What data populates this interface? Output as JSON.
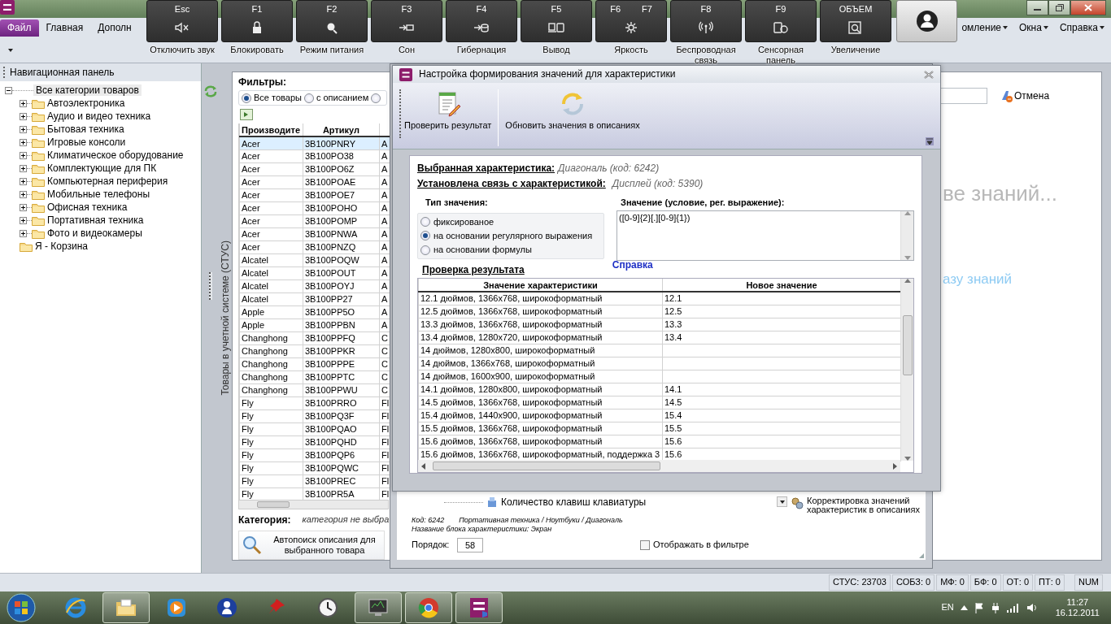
{
  "ribbon": {
    "tabs": [
      {
        "label": "Файл",
        "selected": true
      },
      {
        "label": "Главная",
        "selected": false
      },
      {
        "label": "Дополн",
        "selected": false
      }
    ],
    "menus": [
      "омление",
      "Окна",
      "Справка"
    ]
  },
  "function_keys": [
    {
      "keys": [
        "Esc"
      ],
      "caption": "Отключить звук"
    },
    {
      "keys": [
        "F1"
      ],
      "caption": "Блокировать"
    },
    {
      "keys": [
        "F2"
      ],
      "caption": "Режим питания"
    },
    {
      "keys": [
        "F3"
      ],
      "caption": "Сон"
    },
    {
      "keys": [
        "F4"
      ],
      "caption": "Гибернация"
    },
    {
      "keys": [
        "F5"
      ],
      "caption": "Вывод"
    },
    {
      "keys": [
        "F6",
        "F7"
      ],
      "caption": "Яркость"
    },
    {
      "keys": [
        "F8"
      ],
      "caption": "Беспроводная связь"
    },
    {
      "keys": [
        "F9"
      ],
      "caption": "Сенсорная панель"
    },
    {
      "keys": [
        "ОБЪЕМ"
      ],
      "caption": "Увеличение"
    }
  ],
  "nav_panel": {
    "title": "Навигационная панель",
    "tree": {
      "label": "Все категории товаров",
      "expanded": true,
      "selected": true,
      "children": [
        {
          "label": "Автоэлектроника",
          "expanded": false,
          "selected": false
        },
        {
          "label": "Аудио и видео техника",
          "expanded": false,
          "selected": false
        },
        {
          "label": "Бытовая техника",
          "expanded": false,
          "selected": false
        },
        {
          "label": "Игровые консоли",
          "expanded": false,
          "selected": false
        },
        {
          "label": "Климатическое оборудование",
          "expanded": false,
          "selected": false
        },
        {
          "label": "Комплектующие для ПК",
          "expanded": false,
          "selected": false
        },
        {
          "label": "Компьютерная периферия",
          "expanded": false,
          "selected": false
        },
        {
          "label": "Мобильные телефоны",
          "expanded": false,
          "selected": false
        },
        {
          "label": "Офисная техника",
          "expanded": false,
          "selected": false
        },
        {
          "label": "Портативная техника",
          "expanded": false,
          "selected": false
        },
        {
          "label": "Фото и видеокамеры",
          "expanded": false,
          "selected": false
        },
        {
          "label": "Я - Корзина",
          "selected": false
        }
      ]
    }
  },
  "products": {
    "side_label": "Товары в учетной системе (СТУС)",
    "filters_label": "Фильтры:",
    "filter_options": [
      {
        "label": "Все товары",
        "selected": true
      },
      {
        "label": "с описанием",
        "selected": false
      },
      {
        "selected": false
      }
    ],
    "table": {
      "columns": [
        "Производите",
        "Артикул"
      ],
      "rows": [
        {
          "selected": true,
          "cells": [
            "Acer",
            "3B100PNRY",
            "A"
          ]
        },
        {
          "selected": false,
          "cells": [
            "Acer",
            "3B100PO38",
            "A"
          ]
        },
        {
          "selected": false,
          "cells": [
            "Acer",
            "3B100PO6Z",
            "A"
          ]
        },
        {
          "selected": false,
          "cells": [
            "Acer",
            "3B100POAE",
            "A"
          ]
        },
        {
          "selected": false,
          "cells": [
            "Acer",
            "3B100POE7",
            "A"
          ]
        },
        {
          "selected": false,
          "cells": [
            "Acer",
            "3B100POHO",
            "A"
          ]
        },
        {
          "selected": false,
          "cells": [
            "Acer",
            "3B100POMP",
            "A"
          ]
        },
        {
          "selected": false,
          "cells": [
            "Acer",
            "3B100PNWA",
            "A"
          ]
        },
        {
          "selected": false,
          "cells": [
            "Acer",
            "3B100PNZQ",
            "A"
          ]
        },
        {
          "selected": false,
          "cells": [
            "Alcatel",
            "3B100POQW",
            "A"
          ]
        },
        {
          "selected": false,
          "cells": [
            "Alcatel",
            "3B100POUT",
            "A"
          ]
        },
        {
          "selected": false,
          "cells": [
            "Alcatel",
            "3B100POYJ",
            "A"
          ]
        },
        {
          "selected": false,
          "cells": [
            "Alcatel",
            "3B100PP27",
            "A"
          ]
        },
        {
          "selected": false,
          "cells": [
            "Apple",
            "3B100PP5O",
            "A"
          ]
        },
        {
          "selected": false,
          "cells": [
            "Apple",
            "3B100PPBN",
            "A"
          ]
        },
        {
          "selected": false,
          "cells": [
            "Changhong",
            "3B100PPFQ",
            "C"
          ]
        },
        {
          "selected": false,
          "cells": [
            "Changhong",
            "3B100PPKR",
            "C"
          ]
        },
        {
          "selected": false,
          "cells": [
            "Changhong",
            "3B100PPPE",
            "C"
          ]
        },
        {
          "selected": false,
          "cells": [
            "Changhong",
            "3B100PPTC",
            "C"
          ]
        },
        {
          "selected": false,
          "cells": [
            "Changhong",
            "3B100PPWU",
            "C"
          ]
        },
        {
          "selected": false,
          "cells": [
            "Fly",
            "3B100PRRO",
            "Fl"
          ]
        },
        {
          "selected": false,
          "cells": [
            "Fly",
            "3B100PQ3F",
            "Fl"
          ]
        },
        {
          "selected": false,
          "cells": [
            "Fly",
            "3B100PQAO",
            "Fl"
          ]
        },
        {
          "selected": false,
          "cells": [
            "Fly",
            "3B100PQHD",
            "Fl"
          ]
        },
        {
          "selected": false,
          "cells": [
            "Fly",
            "3B100PQP6",
            "Fl"
          ]
        },
        {
          "selected": false,
          "cells": [
            "Fly",
            "3B100PQWC",
            "Fl"
          ]
        },
        {
          "selected": false,
          "cells": [
            "Fly",
            "3B100PREC",
            "Fl"
          ]
        },
        {
          "selected": false,
          "cells": [
            "Fly",
            "3B100PR5A",
            "Fl"
          ]
        }
      ]
    },
    "category_label": "Категория:",
    "category_value": "категория не выбра",
    "autosearch_button": "Автопоиск описания для выбранного товара"
  },
  "right_pane": {
    "cancel_button": "Отмена",
    "hint_text": "ве знаний...",
    "link": "азу знаний"
  },
  "back_window": {
    "item_label": "Количество клавиш клавиатуры",
    "code": "Код: 6242",
    "path": "Портативная техника / Ноутбуки / Диагональ",
    "block_name": "Название блока характеристики: Экран",
    "order_label": "Порядок:",
    "order_value": "58",
    "show_in_filter": {
      "label": "Отображать в фильтре",
      "checked": false
    },
    "correction_button": "Корректировка значений характеристик в описаниях"
  },
  "dialog": {
    "title": "Настройка формирования значений для характеристики",
    "toolbar": [
      "Проверить результат",
      "Обновить значения в описаниях"
    ],
    "selected_label": "Выбранная характеристика:",
    "selected_value": "Диагональ (код: 6242)",
    "link_label": "Установлена связь с характеристикой:",
    "link_value": "Дисплей (код: 5390)",
    "value_type_label": "Тип значения:",
    "value_types": [
      {
        "label": "фиксированое",
        "selected": false
      },
      {
        "label": "на основании регулярного выражения",
        "selected": true
      },
      {
        "label": "на основании формулы",
        "selected": false
      }
    ],
    "value_label": "Значение (условие, рег. выражение):",
    "value": "([0-9]{2}[.][0-9]{1})",
    "help_link": "Справка",
    "check_label": "Проверка результата",
    "result_table": {
      "columns": [
        "Значение характеристики",
        "Новое значение"
      ],
      "rows": [
        [
          "12.1 дюймов, 1366x768, широкоформатный",
          "12.1"
        ],
        [
          "12.5 дюймов, 1366x768, широкоформатный",
          "12.5"
        ],
        [
          "13.3 дюймов, 1366x768, широкоформатный",
          "13.3"
        ],
        [
          "13.4 дюймов, 1280x720, широкоформатный",
          "13.4"
        ],
        [
          "14 дюймов, 1280x800, широкоформатный"
        ],
        [
          "14 дюймов, 1366x768, широкоформатный"
        ],
        [
          "14 дюймов, 1600x900, широкоформатный"
        ],
        [
          "14.1 дюймов, 1280x800, широкоформатный",
          "14.1"
        ],
        [
          "14.5 дюймов, 1366x768, широкоформатный",
          "14.5"
        ],
        [
          "15.4 дюймов, 1440x900, широкоформатный",
          "15.4"
        ],
        [
          "15.5 дюймов, 1366x768, широкоформатный",
          "15.5"
        ],
        [
          "15.6 дюймов, 1366x768, широкоформатный",
          "15.6"
        ],
        [
          "15.6 дюймов, 1366x768, широкоформатный, поддержка 3",
          "15.6"
        ]
      ]
    }
  },
  "status_bar": [
    "СТУС: 23703",
    "СОБЗ: 0",
    "МФ: 0",
    "БФ: 0",
    "ОТ: 0",
    "ПТ: 0",
    "NUM"
  ],
  "taskbar": {
    "apps": [
      {
        "active": false
      },
      {
        "active": true
      },
      {
        "active": false
      },
      {
        "active": false
      },
      {
        "active": false
      },
      {
        "active": false
      },
      {
        "active": true
      },
      {
        "active": true
      },
      {
        "active": true
      }
    ],
    "language": "EN",
    "time": "11:27",
    "date": "16.12.2011"
  }
}
